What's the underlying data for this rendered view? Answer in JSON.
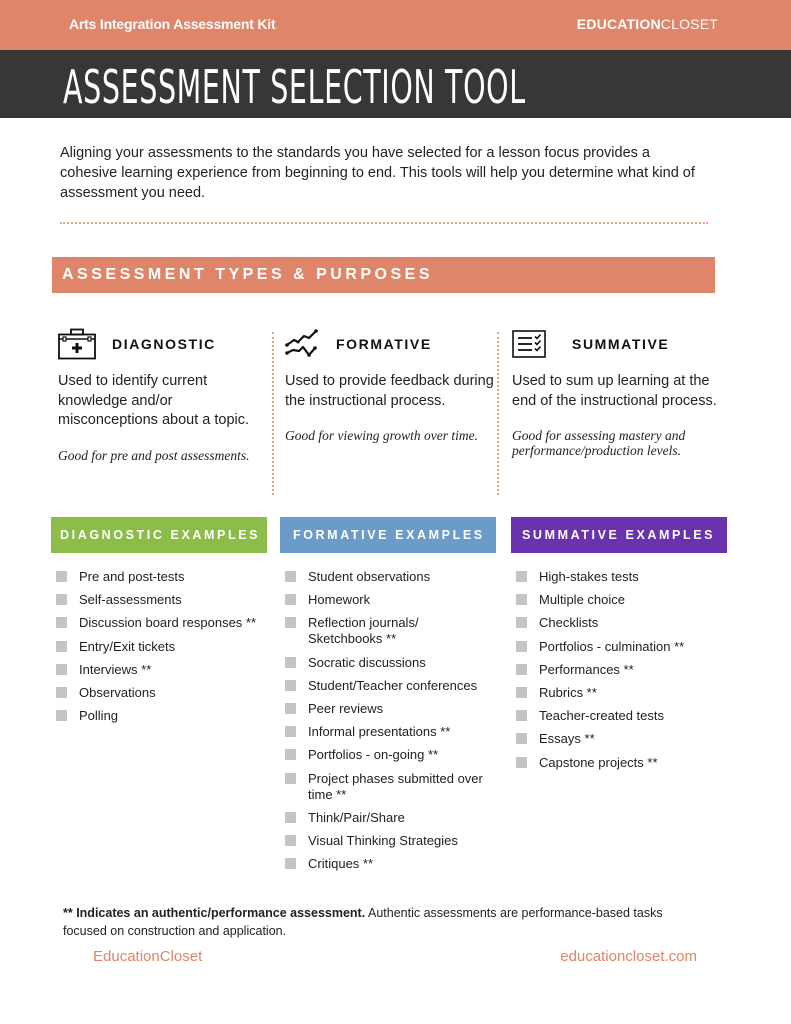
{
  "header": {
    "kit_title": "Arts Integration Assessment Kit",
    "brand_bold": "EDUCATION",
    "brand_light": "CLOSET",
    "page_title": "ASSESSMENT SELECTION TOOL"
  },
  "intro": "Aligning your assessments to the standards you have selected for a lesson focus provides a cohesive learning experience from beginning to end.  This tools will help you determine what kind of assessment you need.",
  "section_banner": "ASSESSMENT TYPES & PURPOSES",
  "colors": {
    "accent_orange": "#df8569",
    "title_dark": "#373737",
    "diagnostic_green": "#8bbd48",
    "formative_blue": "#6b9bc9",
    "summative_purple": "#6a32ae",
    "bullet_gray": "#c4c4c4"
  },
  "types": [
    {
      "icon": "first-aid-kit-icon",
      "name": "DIAGNOSTIC",
      "description": "Used to identify current knowledge and/or misconceptions about a topic.",
      "note": "Good for pre and post assessments."
    },
    {
      "icon": "growth-lines-icon",
      "name": "FORMATIVE",
      "description": "Used to provide feedback during the instructional process.",
      "note": "Good for viewing growth over time."
    },
    {
      "icon": "checklist-icon",
      "name": "SUMMATIVE",
      "description": "Used to sum up learning at the end of the instructional process.",
      "note": "Good for assessing mastery and performance/production levels."
    }
  ],
  "examples": [
    {
      "title": "DIAGNOSTIC EXAMPLES",
      "items": [
        "Pre and post-tests",
        "Self-assessments",
        "Discussion board responses **",
        "Entry/Exit tickets",
        "Interviews **",
        "Observations",
        "Polling"
      ]
    },
    {
      "title": "FORMATIVE EXAMPLES",
      "items": [
        "Student observations",
        "Homework",
        "Reflection journals/ Sketchbooks **",
        "Socratic discussions",
        "Student/Teacher conferences",
        "Peer reviews",
        "Informal presentations **",
        "Portfolios - on-going **",
        "Project phases submitted over time **",
        "Think/Pair/Share",
        "Visual Thinking Strategies",
        "Critiques **"
      ]
    },
    {
      "title": "SUMMATIVE EXAMPLES",
      "items": [
        "High-stakes tests",
        "Multiple choice",
        "Checklists",
        "Portfolios - culmination **",
        "Performances **",
        "Rubrics **",
        "Teacher-created tests",
        "Essays **",
        "Capstone projects **"
      ]
    }
  ],
  "footnote": {
    "bold": "** Indicates an authentic/performance assessment.",
    "text": " Authentic assessments are performance-based tasks focused on construction and application."
  },
  "footer": {
    "left": "EducationCloset",
    "right": "educationcloset.com"
  }
}
